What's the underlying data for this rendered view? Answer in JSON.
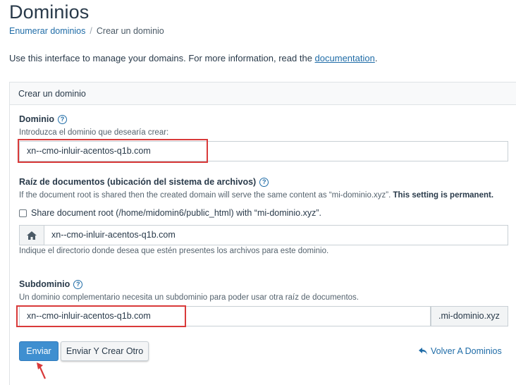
{
  "page": {
    "title": "Dominios"
  },
  "breadcrumb": {
    "parent": "Enumerar dominios",
    "separator": "/",
    "current": "Crear un dominio"
  },
  "intro": {
    "text": "Use this interface to manage your domains. For more information, read the ",
    "link": "documentation",
    "end": "."
  },
  "card": {
    "header": "Crear un dominio"
  },
  "domain": {
    "label": "Dominio",
    "hint": "Introduzca el dominio que desearía crear:",
    "value": "xn--cmo-inluir-acentos-q1b.com"
  },
  "docroot": {
    "label": "Raíz de documentos (ubicación del sistema de archivos)",
    "hint_start": "If the document root is shared then the created domain will serve the same content as “mi-dominio.xyz”. ",
    "hint_bold": "This setting is permanent.",
    "share_label": "Share document root (/home/midomin6/public_html) with “mi-dominio.xyz”.",
    "share_checked": false,
    "value": "xn--cmo-inluir-acentos-q1b.com",
    "hint_after": "Indique el directorio donde desea que estén presentes los archivos para este dominio.",
    "icon": "home-icon"
  },
  "subdomain": {
    "label": "Subdominio",
    "hint": "Un dominio complementario necesita un subdominio para poder usar otra raíz de documentos.",
    "value": "xn--cmo-inluir-acentos-q1b.com",
    "suffix": ".mi-dominio.xyz"
  },
  "actions": {
    "submit": "Enviar",
    "submit_another": "Enviar Y Crear Otro",
    "back": "Volver A Dominios",
    "back_icon": "undo-arrow-icon"
  },
  "colors": {
    "primary": "#3f8fd0",
    "link": "#1f6ca7",
    "highlight": "#d93a3a"
  }
}
